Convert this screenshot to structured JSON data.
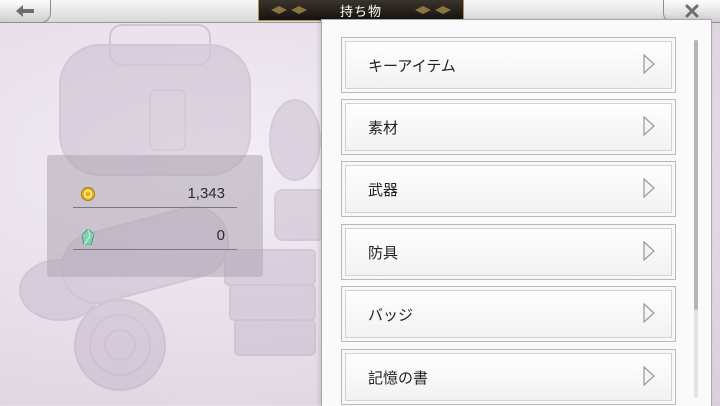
{
  "header": {
    "title": "持ち物",
    "back_icon": "back-arrow-icon",
    "close_icon": "close-x-icon"
  },
  "currency": [
    {
      "icon": "gold-coin-icon",
      "amount": "1,343"
    },
    {
      "icon": "crystal-gem-icon",
      "amount": "0"
    }
  ],
  "items_menu": [
    {
      "label": "キーアイテム"
    },
    {
      "label": "素材"
    },
    {
      "label": "武器"
    },
    {
      "label": "防具"
    },
    {
      "label": "バッジ"
    },
    {
      "label": "記憶の書"
    }
  ],
  "colors": {
    "title_bg": "#1f1a15",
    "title_border": "#b08e4e",
    "coin": "#e8b420",
    "gem": "#7fd3a8"
  }
}
